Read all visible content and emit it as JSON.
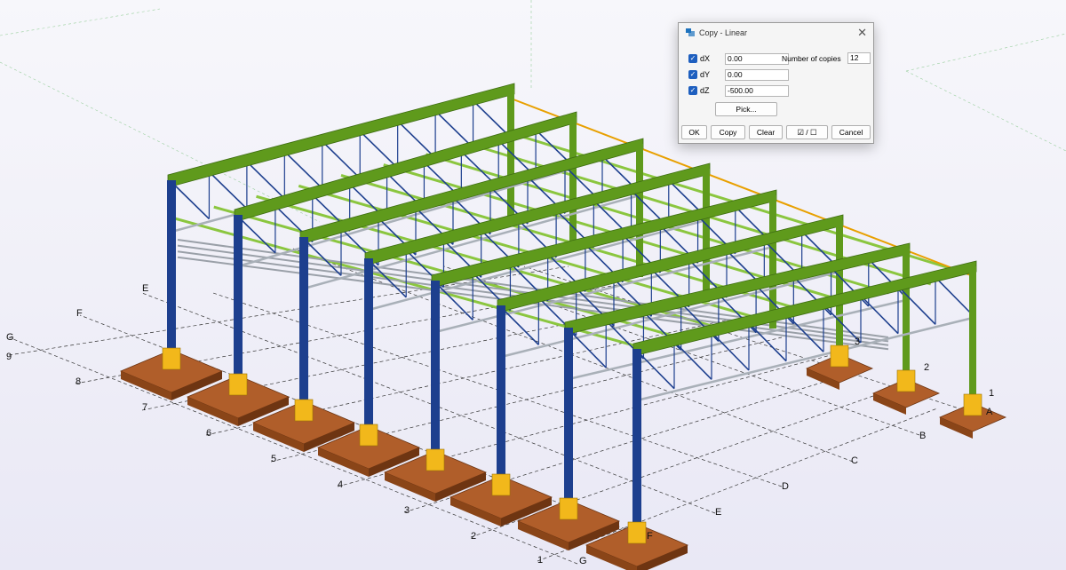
{
  "dialog": {
    "title": "Copy - Linear",
    "dx": {
      "label": "dX",
      "value": "0.00",
      "checked": true
    },
    "dy": {
      "label": "dY",
      "value": "0.00",
      "checked": true
    },
    "dz": {
      "label": "dZ",
      "value": "-500.00",
      "checked": true
    },
    "copies_label": "Number of copies",
    "copies_value": "12",
    "pick_label": "Pick...",
    "buttons": {
      "ok": "OK",
      "copy": "Copy",
      "clear": "Clear",
      "toggle": "☑ / ☐",
      "cancel": "Cancel"
    },
    "close_glyph": "✕"
  },
  "grid": {
    "numbers": [
      "1",
      "2",
      "3",
      "4",
      "5",
      "6",
      "7",
      "8",
      "9"
    ],
    "letters": [
      "A",
      "B",
      "C",
      "D",
      "E",
      "F",
      "G"
    ]
  },
  "colors": {
    "column": "#1d3f8e",
    "rafter": "#5f9a1c",
    "purlin": "#8bc63f",
    "footing": "#b05e2a",
    "baseplate": "#f2b81b",
    "tie": "#e8a000",
    "grid_line": "#333333"
  }
}
